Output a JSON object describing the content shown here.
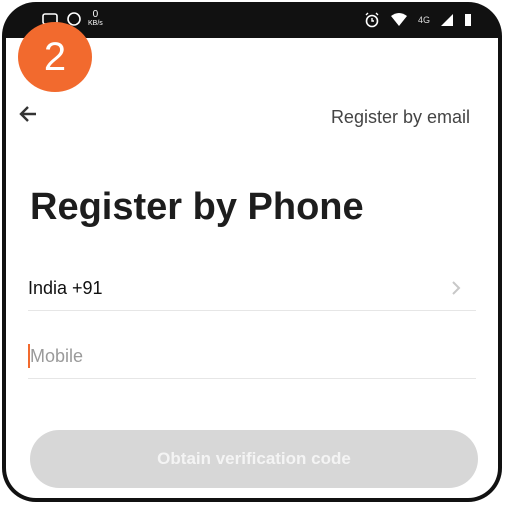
{
  "status_bar": {
    "net_speed_value": "0",
    "net_speed_unit": "KB/s",
    "network_type": "4G"
  },
  "step_badge": "2",
  "header": {
    "switch_link": "Register by email"
  },
  "page": {
    "title": "Register by Phone"
  },
  "form": {
    "country_value": "India +91",
    "mobile_placeholder": "Mobile",
    "submit_label": "Obtain verification code"
  },
  "colors": {
    "accent": "#f26a2e",
    "button_disabled": "#d7d7d7"
  }
}
